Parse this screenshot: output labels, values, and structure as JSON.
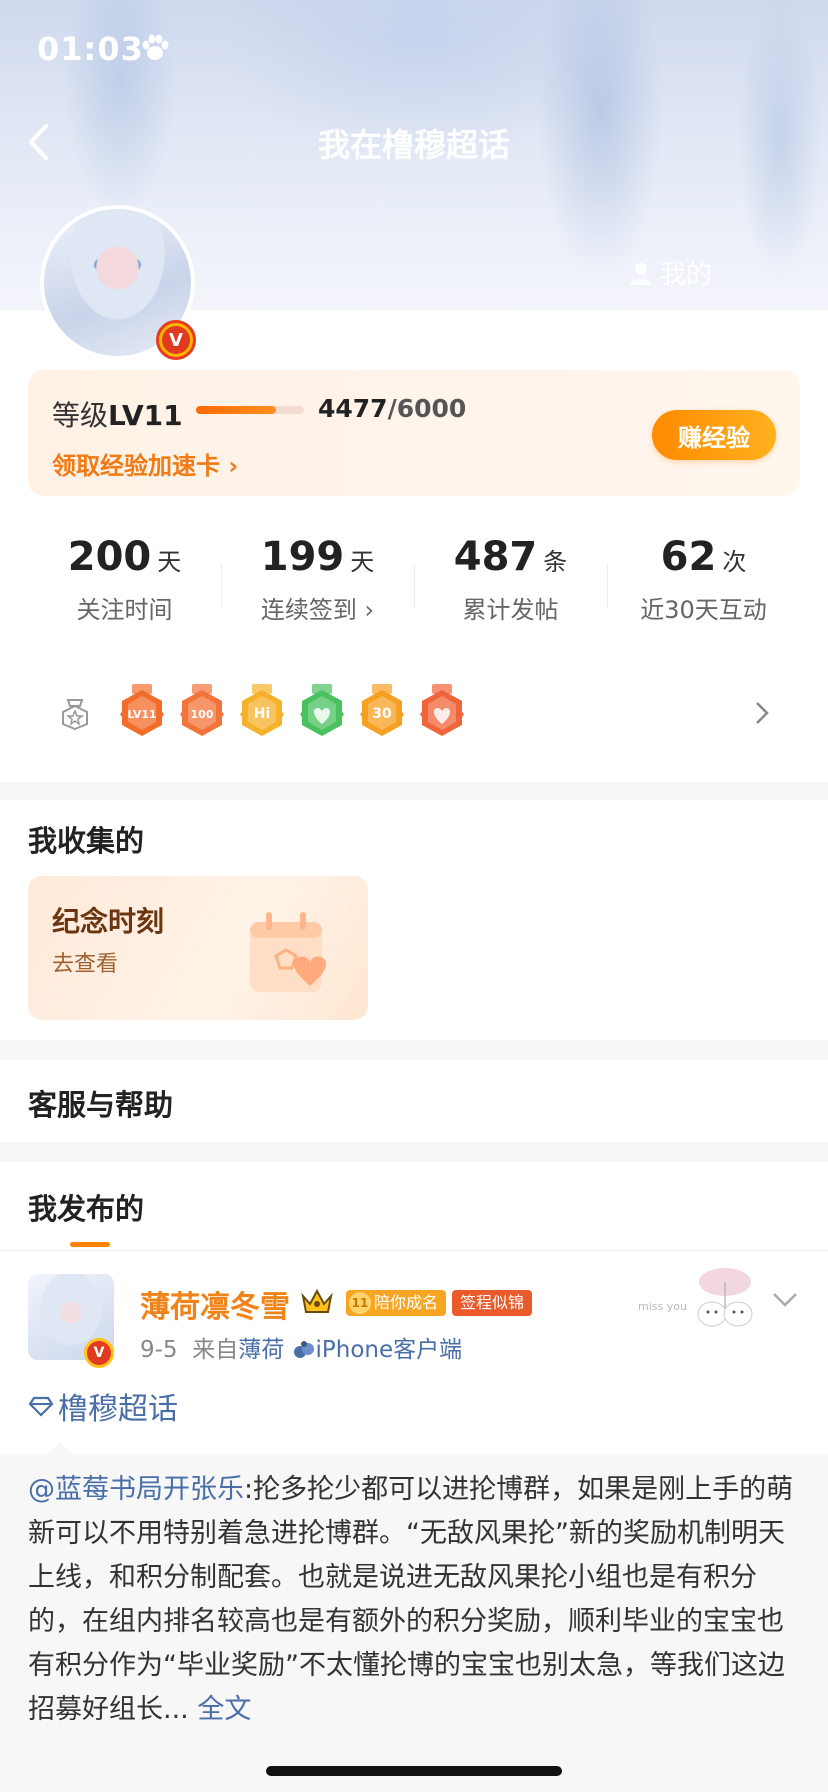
{
  "status_bar": {
    "time": "01:03"
  },
  "nav": {
    "title": "我在橹穆超话",
    "my_link": "我的"
  },
  "level": {
    "label_prefix": "等级",
    "level": "LV11",
    "progress_fraction": 0.745,
    "current": "4477",
    "total": "/6000",
    "boost_link": "领取经验加速卡 ›",
    "earn_button": "赚经验"
  },
  "stats": [
    {
      "num": "200",
      "unit": "天",
      "label": "关注时间"
    },
    {
      "num": "199",
      "unit": "天",
      "label": "连续签到 ›"
    },
    {
      "num": "487",
      "unit": "条",
      "label": "累计发帖"
    },
    {
      "num": "62",
      "unit": "次",
      "label": "近30天互动"
    }
  ],
  "medals": [
    {
      "icon": "lv11-medal-icon",
      "text": "LV11",
      "color": "#f36d2a"
    },
    {
      "icon": "100-days-medal-icon",
      "text": "100",
      "color": "#f2743a"
    },
    {
      "icon": "hi-medal-icon",
      "text": "Hi",
      "color": "#f6b12a"
    },
    {
      "icon": "hands-medal-icon",
      "text": "",
      "color": "#48c15e"
    },
    {
      "icon": "30-days-medal-icon",
      "text": "30",
      "color": "#f6a022"
    },
    {
      "icon": "heart-medal-icon",
      "text": "",
      "color": "#f0643a"
    }
  ],
  "collected": {
    "title": "我收集的",
    "card_title": "纪念时刻",
    "card_sub": "去查看"
  },
  "help": {
    "title": "客服与帮助"
  },
  "posts": {
    "title": "我发布的",
    "post": {
      "username": "薄荷凛冬雪",
      "tag1_num": "11",
      "tag1": "陪你成名",
      "tag2": "签程似锦",
      "date": "9-5",
      "from_prefix": "来自",
      "from_name": "薄荷",
      "client": "iPhone客户端",
      "topic": "橹穆超话",
      "mention": "@蓝莓书局开张乐",
      "body": ":抡多抡少都可以进抡博群，如果是刚上手的萌新可以不用特别着急进抡博群。“无敌风果抡”新的奖励机制明天上线，和积分制配套。也就是说进无敌风果抡小组也是有积分的，在组内排名较高也是有额外的积分奖励，顺利毕业的宝宝也有积分作为“毕业奖励”不太懂抡博的宝宝也别太急，等我们这边招募好组长...",
      "full_link": " 全文"
    }
  },
  "colors": {
    "accent": "#ff8200",
    "link": "#4a6ea8",
    "username": "#f08418"
  }
}
